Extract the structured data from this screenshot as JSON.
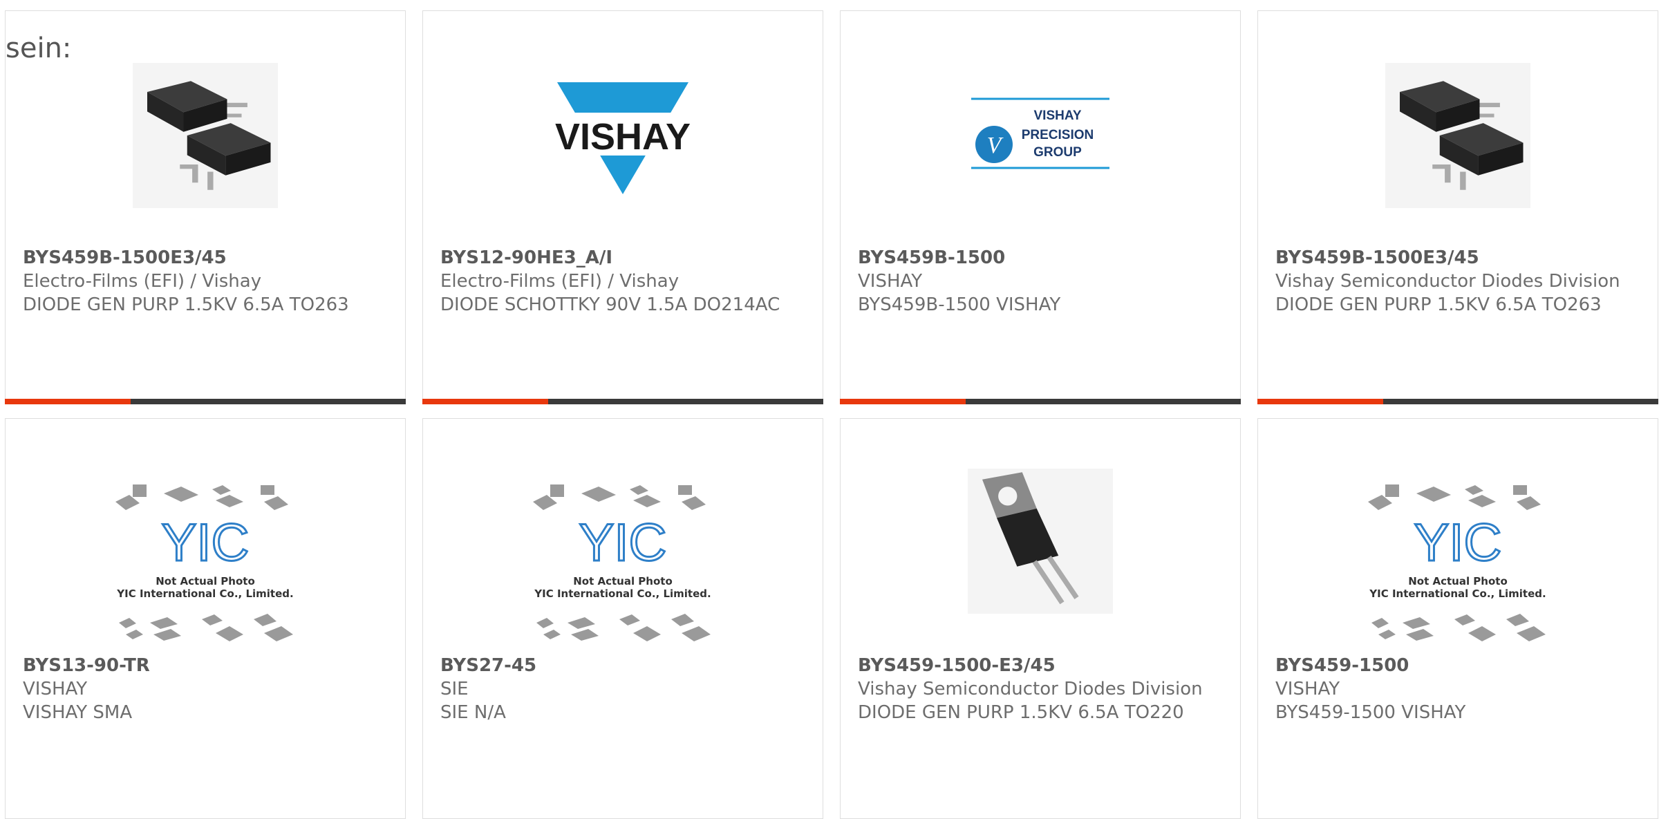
{
  "heading": "sein:",
  "colors": {
    "accent": "#e8380d",
    "bar": "#3a3a3a",
    "vishay_blue": "#1e9ad6",
    "yic_blue": "#2e7fc8"
  },
  "cards": [
    {
      "part": "BYS459B-1500E3/45",
      "maker": "Electro-Films (EFI) / Vishay",
      "desc": "DIODE GEN PURP 1.5KV 6.5A TO263",
      "image": "to263-package-photo"
    },
    {
      "part": "BYS12-90HE3_A/I",
      "maker": "Electro-Films (EFI) / Vishay",
      "desc": "DIODE SCHOTTKY 90V 1.5A DO214AC",
      "image": "vishay-logo",
      "logo_text": "VISHAY"
    },
    {
      "part": "BYS459B-1500",
      "maker": "VISHAY",
      "desc": "BYS459B-1500 VISHAY",
      "image": "vishay-precision-group-logo",
      "logo_lines": [
        "VISHAY",
        "PRECISION",
        "GROUP"
      ]
    },
    {
      "part": "BYS459B-1500E3/45",
      "maker": "Vishay Semiconductor Diodes Division",
      "desc": "DIODE GEN PURP 1.5KV 6.5A TO263",
      "image": "to263-package-photo"
    },
    {
      "part": "BYS13-90-TR",
      "maker": "VISHAY",
      "desc": "VISHAY SMA",
      "image": "yic-placeholder",
      "placeholder_lines": [
        "YIC",
        "Not Actual Photo",
        "YIC International Co., Limited."
      ]
    },
    {
      "part": "BYS27-45",
      "maker": "SIE",
      "desc": "SIE N/A",
      "image": "yic-placeholder",
      "placeholder_lines": [
        "YIC",
        "Not Actual Photo",
        "YIC International Co., Limited."
      ]
    },
    {
      "part": "BYS459-1500-E3/45",
      "maker": "Vishay Semiconductor Diodes Division",
      "desc": "DIODE GEN PURP 1.5KV 6.5A TO220",
      "image": "to220-package-photo"
    },
    {
      "part": "BYS459-1500",
      "maker": "VISHAY",
      "desc": "BYS459-1500 VISHAY",
      "image": "yic-placeholder",
      "placeholder_lines": [
        "YIC",
        "Not Actual Photo",
        "YIC International Co., Limited."
      ]
    }
  ]
}
